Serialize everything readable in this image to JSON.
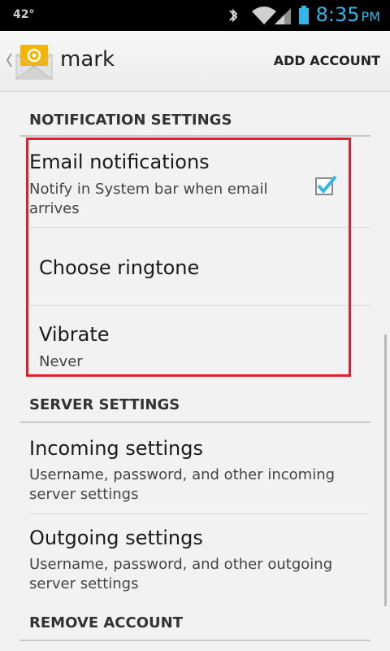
{
  "status_bar": {
    "left_text": "42°",
    "time": "8:35",
    "ampm": "PM",
    "icons": [
      "bluetooth-icon",
      "wifi-icon",
      "signal-icon",
      "battery-icon"
    ],
    "accent_color": "#33b5e5"
  },
  "action_bar": {
    "account_name": "mark",
    "add_account_label": "ADD ACCOUNT",
    "app_icon": "email-envelope-icon"
  },
  "notification_settings": {
    "header": "NOTIFICATION SETTINGS",
    "email_notifications": {
      "title": "Email notifications",
      "summary": "Notify in System bar when email arrives",
      "checked": true
    },
    "choose_ringtone": {
      "title": "Choose ringtone"
    },
    "vibrate": {
      "title": "Vibrate",
      "summary": "Never"
    }
  },
  "server_settings": {
    "header": "SERVER SETTINGS",
    "incoming": {
      "title": "Incoming settings",
      "summary": "Username, password, and other incoming server settings"
    },
    "outgoing": {
      "title": "Outgoing settings",
      "summary": "Username, password, and other outgoing server settings"
    }
  },
  "remove_account": {
    "header": "REMOVE ACCOUNT"
  },
  "highlight_color": "#e51d2e"
}
